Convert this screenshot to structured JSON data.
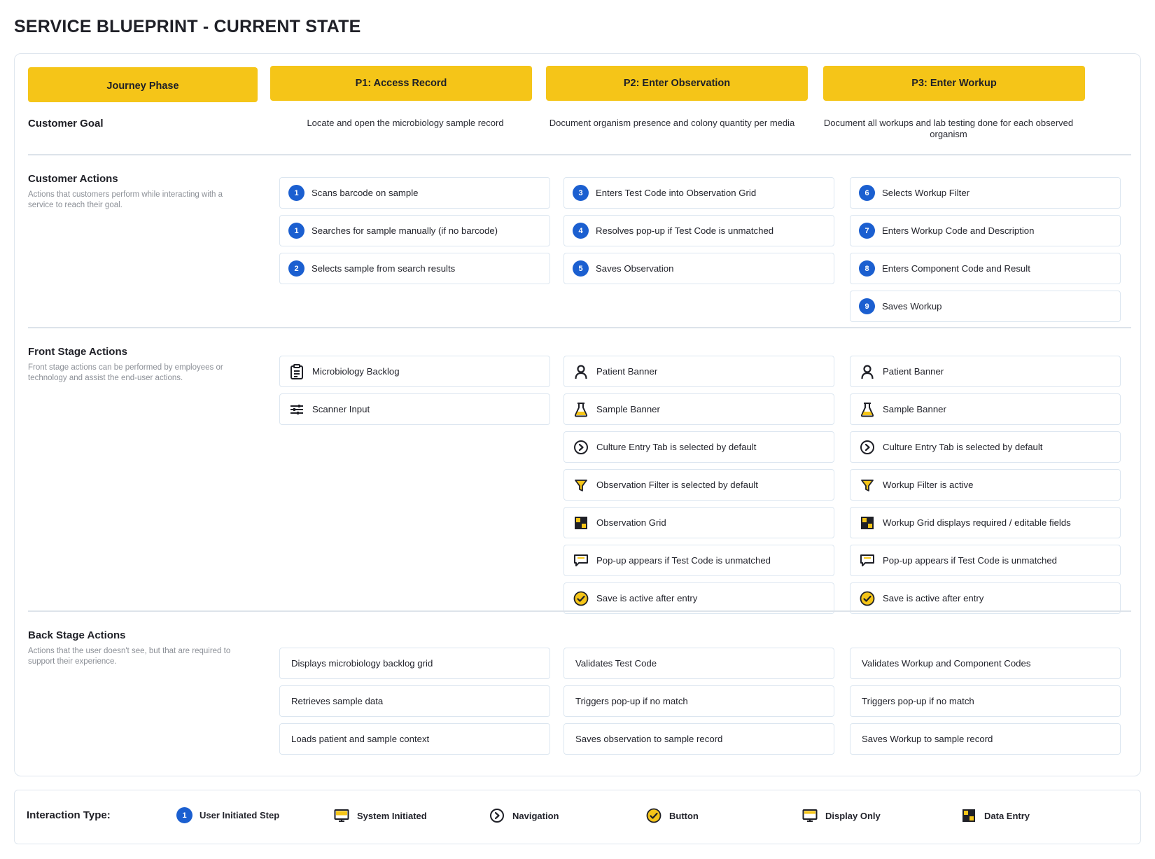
{
  "page_title": "SERVICE BLUEPRINT - CURRENT STATE",
  "phases": {
    "label": "Journey Phase",
    "p1": "P1: Access Record",
    "p2": "P2: Enter Observation",
    "p3": "P3: Enter Workup"
  },
  "customer_goal": {
    "label": "Customer Goal",
    "p1": "Locate and open the microbiology sample record",
    "p2": "Document organism presence and colony quantity per media",
    "p3": "Document all workups and lab testing done for each observed organism"
  },
  "customer_actions": {
    "title": "Customer Actions",
    "description": "Actions that customers perform while interacting with a service to reach their goal.",
    "p1": [
      {
        "step": "1",
        "label": "Scans barcode on sample"
      },
      {
        "step": "1",
        "label": "Searches for sample manually (if no barcode)"
      },
      {
        "step": "2",
        "label": "Selects sample from search results"
      }
    ],
    "p2": [
      {
        "step": "3",
        "label": "Enters Test Code into Observation Grid"
      },
      {
        "step": "4",
        "label": "Resolves pop-up if Test Code is unmatched"
      },
      {
        "step": "5",
        "label": "Saves Observation"
      }
    ],
    "p3": [
      {
        "step": "6",
        "label": "Selects Workup Filter"
      },
      {
        "step": "7",
        "label": "Enters Workup Code and Description"
      },
      {
        "step": "8",
        "label": "Enters Component Code and Result"
      },
      {
        "step": "9",
        "label": "Saves Workup"
      }
    ]
  },
  "front_stage": {
    "title": "Front Stage Actions",
    "description": "Front stage actions can be performed by employees or technology and assist the end-user actions.",
    "p1": [
      {
        "icon": "clipboard-icon",
        "label": "Microbiology Backlog"
      },
      {
        "icon": "sliders-icon",
        "label": "Scanner Input"
      }
    ],
    "p2": [
      {
        "icon": "person-icon",
        "label": "Patient Banner"
      },
      {
        "icon": "flask-icon",
        "label": "Sample Banner"
      },
      {
        "icon": "navigation-icon",
        "label": "Culture Entry Tab is selected by default"
      },
      {
        "icon": "filter-icon",
        "label": "Observation Filter is selected by default"
      },
      {
        "icon": "grid-icon",
        "label": "Observation Grid"
      },
      {
        "icon": "message-icon",
        "label": "Pop-up appears if Test Code is unmatched"
      },
      {
        "icon": "check-icon",
        "label": "Save is active after entry"
      }
    ],
    "p3": [
      {
        "icon": "person-icon",
        "label": "Patient Banner"
      },
      {
        "icon": "flask-icon",
        "label": "Sample Banner"
      },
      {
        "icon": "navigation-icon",
        "label": "Culture Entry Tab is selected by default"
      },
      {
        "icon": "filter-icon",
        "label": "Workup Filter is active"
      },
      {
        "icon": "grid-icon",
        "label": "Workup Grid displays required / editable fields"
      },
      {
        "icon": "message-icon",
        "label": "Pop-up appears if Test Code is unmatched"
      },
      {
        "icon": "check-icon",
        "label": "Save is active after entry"
      }
    ]
  },
  "back_stage": {
    "title": "Back Stage Actions",
    "description": "Actions that the user doesn't see, but that are required to support their experience.",
    "p1": [
      "Displays microbiology backlog grid",
      "Retrieves sample data",
      "Loads patient and sample context"
    ],
    "p2": [
      "Validates Test Code",
      "Triggers pop-up if no match",
      "Saves observation to sample record"
    ],
    "p3": [
      "Validates Workup and Component Codes",
      "Triggers pop-up if no match",
      "Saves Workup to sample record"
    ]
  },
  "legend": {
    "title": "Interaction Type:",
    "items": [
      {
        "icon": "step-number-icon",
        "step": "1",
        "label": "User Initiated Step"
      },
      {
        "icon": "monitor-icon",
        "label": "System Initiated"
      },
      {
        "icon": "navigation-icon",
        "label": "Navigation"
      },
      {
        "icon": "check-icon",
        "label": "Button"
      },
      {
        "icon": "display-icon",
        "label": "Display Only"
      },
      {
        "icon": "grid-icon",
        "label": "Data Entry"
      }
    ]
  },
  "colors": {
    "phase_yellow": "#f5c518",
    "step_blue": "#1b5fd0",
    "card_border": "#dce6f0",
    "description_gray": "#8c9097"
  }
}
